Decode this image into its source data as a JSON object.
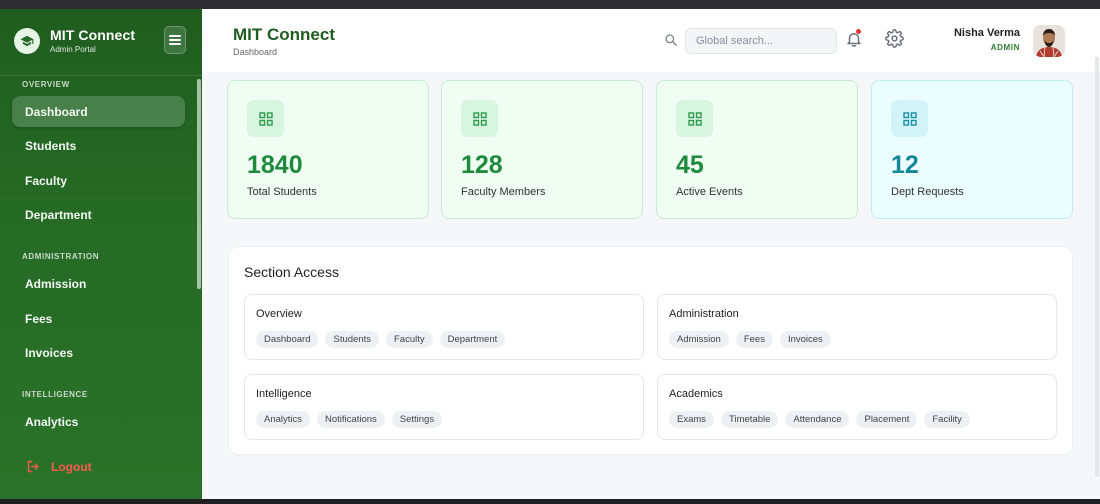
{
  "sidebar": {
    "brand_title": "MIT Connect",
    "brand_subtitle": "Admin Portal",
    "sections": [
      {
        "label": "OVERVIEW",
        "items": [
          "Dashboard",
          "Students",
          "Faculty",
          "Department"
        ]
      },
      {
        "label": "ADMINISTRATION",
        "items": [
          "Admission",
          "Fees",
          "Invoices"
        ]
      },
      {
        "label": "INTELLIGENCE",
        "items": [
          "Analytics"
        ]
      }
    ],
    "active_item": "Dashboard",
    "logout_label": "Logout"
  },
  "header": {
    "title": "MIT Connect",
    "breadcrumb": "Dashboard",
    "search_placeholder": "Global search...",
    "user_name": "Nisha Verma",
    "user_role": "ADMIN"
  },
  "stats": [
    {
      "value": "1840",
      "label": "Total Students",
      "color": "#1e8b3c"
    },
    {
      "value": "128",
      "label": "Faculty Members",
      "color": "#1e8b3c"
    },
    {
      "value": "45",
      "label": "Active Events",
      "color": "#1e8b3c"
    },
    {
      "value": "12",
      "label": "Dept Requests",
      "color": "#15879a"
    }
  ],
  "section_access": {
    "title": "Section Access",
    "groups": [
      {
        "title": "Overview",
        "chips": [
          "Dashboard",
          "Students",
          "Faculty",
          "Department"
        ]
      },
      {
        "title": "Administration",
        "chips": [
          "Admission",
          "Fees",
          "Invoices"
        ]
      },
      {
        "title": "Intelligence",
        "chips": [
          "Analytics",
          "Notifications",
          "Settings"
        ]
      },
      {
        "title": "Academics",
        "chips": [
          "Exams",
          "Timetable",
          "Attendance",
          "Placement",
          "Facility"
        ]
      }
    ]
  },
  "colors": {
    "brand": "#256a25",
    "accent": "#1e8b3c",
    "logout": "#ff5a4c"
  }
}
